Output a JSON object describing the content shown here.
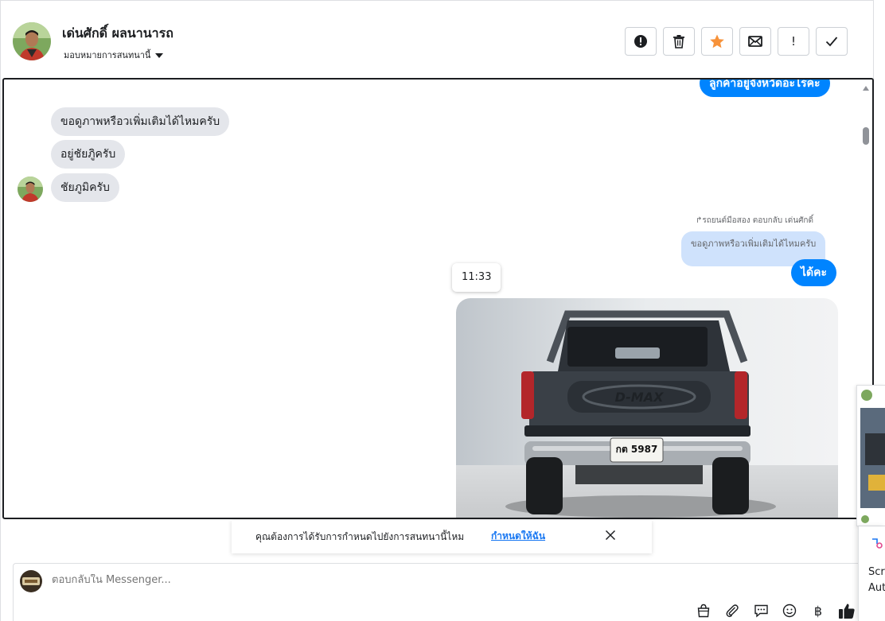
{
  "header": {
    "contact_name": "เด่นศักดิ์ ผลนานารถ",
    "assign_label": "มอบหมายการสนทนานี้",
    "toolbar": [
      {
        "name": "spam-icon"
      },
      {
        "name": "trash-icon"
      },
      {
        "name": "star-icon"
      },
      {
        "name": "mail-icon"
      },
      {
        "name": "exclamation-icon",
        "glyph": "!"
      },
      {
        "name": "check-icon"
      }
    ]
  },
  "conversation": {
    "clipped_top_message": "ลูกค้าอยู่จังหวัดอะไรคะ",
    "incoming": [
      "ขอดูภาพหรือวเพิ่มเติมได้ไหมครับ",
      "อยู่ชัยภูิครับ",
      "ชัยภูมิครับ"
    ],
    "reply_note": "↱รถยนต์มือสอง ตอบกลับ เด่นศักดิ์",
    "quoted_text": "ขอดูภาพหรือวเพิ่มเติมได้ไหมครับ",
    "outgoing_reply": "ได้คะ",
    "timestamp": "11:33",
    "photo_plate": "กต 5987",
    "photo_tailgate": "D-MAX"
  },
  "suggestion": {
    "text": "คุณต้องการได้รับการกำหนดไปยังการสนทนานี้ไหม",
    "link": "กำหนดให้ฉัน"
  },
  "composer": {
    "placeholder": "ตอบกลับใน Messenger...",
    "tools": [
      "bag-icon",
      "paperclip-icon",
      "speech-icon",
      "emoji-icon",
      "baht-icon",
      "like-icon"
    ],
    "baht_glyph": "฿"
  },
  "side_card": {
    "line1": "Scre",
    "line2": "Aut"
  },
  "colors": {
    "accent": "#0084ff",
    "star": "#f7923a",
    "link": "#1877f2",
    "bubble_in": "#e4e6eb",
    "quote": "#cfe2fc"
  }
}
